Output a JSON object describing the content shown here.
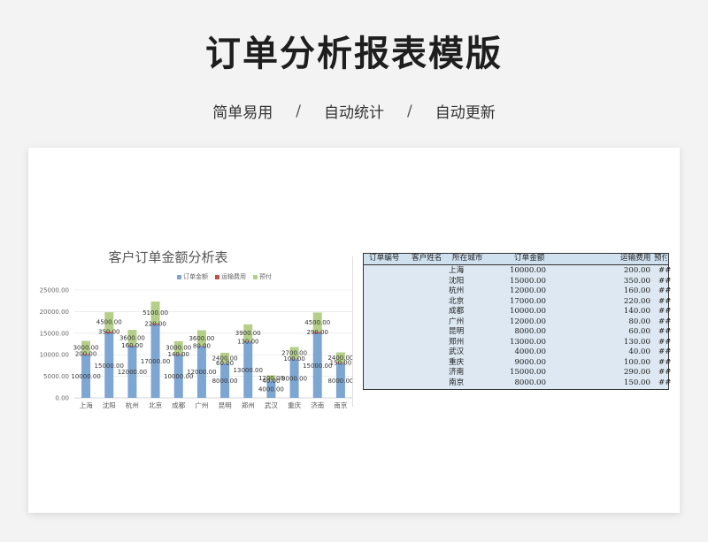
{
  "header": {
    "title": "订单分析报表模版",
    "features": [
      "简单易用",
      "自动统计",
      "自动更新"
    ],
    "separator": "/"
  },
  "chart_data": {
    "type": "bar",
    "stacked": true,
    "title": "客户订单金额分析表",
    "categories": [
      "上海",
      "沈阳",
      "杭州",
      "北京",
      "成都",
      "广州",
      "昆明",
      "郑州",
      "武汉",
      "重庆",
      "济南",
      "南京"
    ],
    "series": [
      {
        "name": "订单金额",
        "color": "#7ea6d3",
        "values": [
          10000,
          15000,
          12000,
          17000,
          10000,
          12000,
          8000,
          13000,
          4000,
          9000,
          15000,
          8000
        ],
        "labels": [
          "10000.00",
          "15000.00",
          "12000.00",
          "17000.00",
          "10000.00",
          "12000.00",
          "8000.00",
          "13000.00",
          "4000.00",
          "9000.00",
          "15000.00",
          "8000.00"
        ]
      },
      {
        "name": "运输费用",
        "color": "#c0504d",
        "values": [
          200,
          350,
          160,
          220,
          140,
          80,
          60,
          130,
          40,
          100,
          290,
          150
        ],
        "labels": [
          "200.00",
          "350.00",
          "160.00",
          "220.00",
          "140.00",
          "80.00",
          "60.00",
          "130.00",
          "40.00",
          "100.00",
          "290.00",
          "150.00"
        ]
      },
      {
        "name": "预付",
        "color": "#b5cf8a",
        "values": [
          3000,
          4500,
          3600,
          5100,
          3000,
          3600,
          2400,
          3900,
          1200,
          2700,
          4500,
          2400
        ],
        "labels": [
          "3000.00",
          "4500.00",
          "3600.00",
          "5100.00",
          "3000.00",
          "3600.00",
          "2400.00",
          "3900.00",
          "1200.00",
          "2700.00",
          "4500.00",
          "2400.00"
        ]
      }
    ],
    "yticks": [
      "0.00",
      "5000.00",
      "10000.00",
      "15000.00",
      "20000.00",
      "25000.00"
    ],
    "ylim": [
      0,
      25000
    ],
    "grid": true,
    "legend": "top"
  },
  "table": {
    "headers": [
      "订单编号",
      "客户姓名",
      "所在城市",
      "订单金额",
      "运输费用",
      "预付"
    ],
    "header_overflow": "预付",
    "overflow": "##",
    "rows": [
      {
        "city": "上海",
        "amount": "10000.00",
        "freight": "200.00"
      },
      {
        "city": "沈阳",
        "amount": "15000.00",
        "freight": "350.00"
      },
      {
        "city": "杭州",
        "amount": "12000.00",
        "freight": "160.00"
      },
      {
        "city": "北京",
        "amount": "17000.00",
        "freight": "220.00"
      },
      {
        "city": "成都",
        "amount": "10000.00",
        "freight": "140.00"
      },
      {
        "city": "广州",
        "amount": "12000.00",
        "freight": "80.00"
      },
      {
        "city": "昆明",
        "amount": "8000.00",
        "freight": "60.00"
      },
      {
        "city": "郑州",
        "amount": "13000.00",
        "freight": "130.00"
      },
      {
        "city": "武汉",
        "amount": "4000.00",
        "freight": "40.00"
      },
      {
        "city": "重庆",
        "amount": "9000.00",
        "freight": "100.00"
      },
      {
        "city": "济南",
        "amount": "15000.00",
        "freight": "290.00"
      },
      {
        "city": "南京",
        "amount": "8000.00",
        "freight": "150.00"
      }
    ]
  }
}
